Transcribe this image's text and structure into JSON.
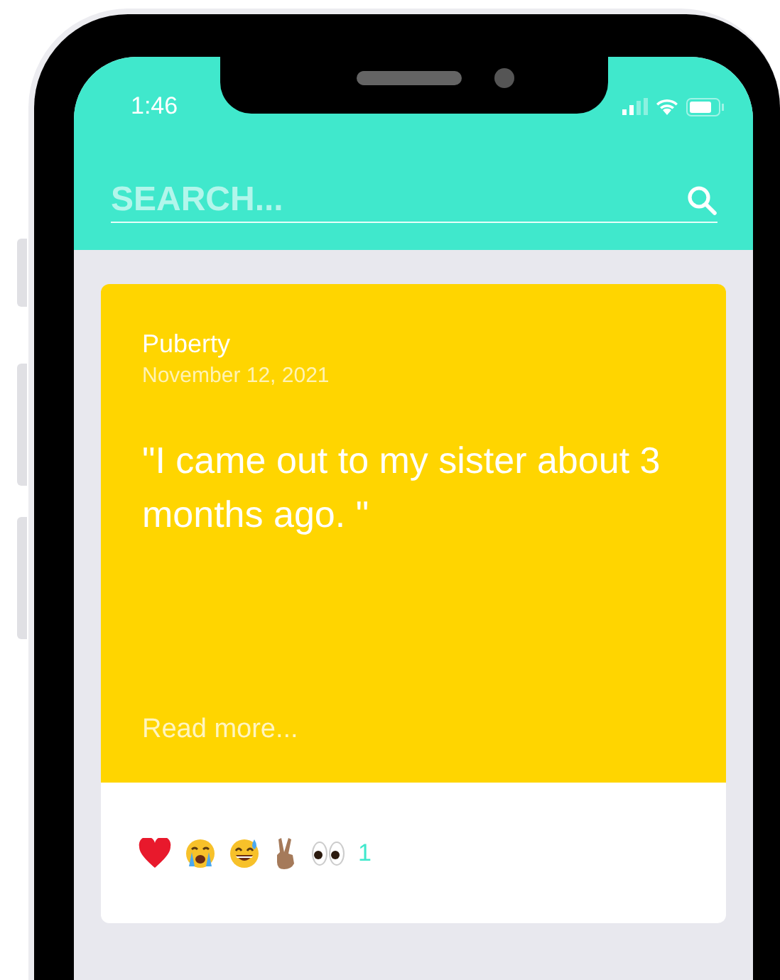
{
  "status_bar": {
    "time": "1:46"
  },
  "search": {
    "placeholder": "SEARCH..."
  },
  "posts": [
    {
      "category": "Puberty",
      "date": "November 12, 2021",
      "quote": "\"I came out to my sister about 3 months ago. \"",
      "link": "Read more...",
      "reactions": [
        {
          "kind": "heart"
        },
        {
          "kind": "crying"
        },
        {
          "kind": "sweat-smile"
        },
        {
          "kind": "peace"
        },
        {
          "kind": "eyes"
        }
      ],
      "reaction_count": "1"
    }
  ]
}
